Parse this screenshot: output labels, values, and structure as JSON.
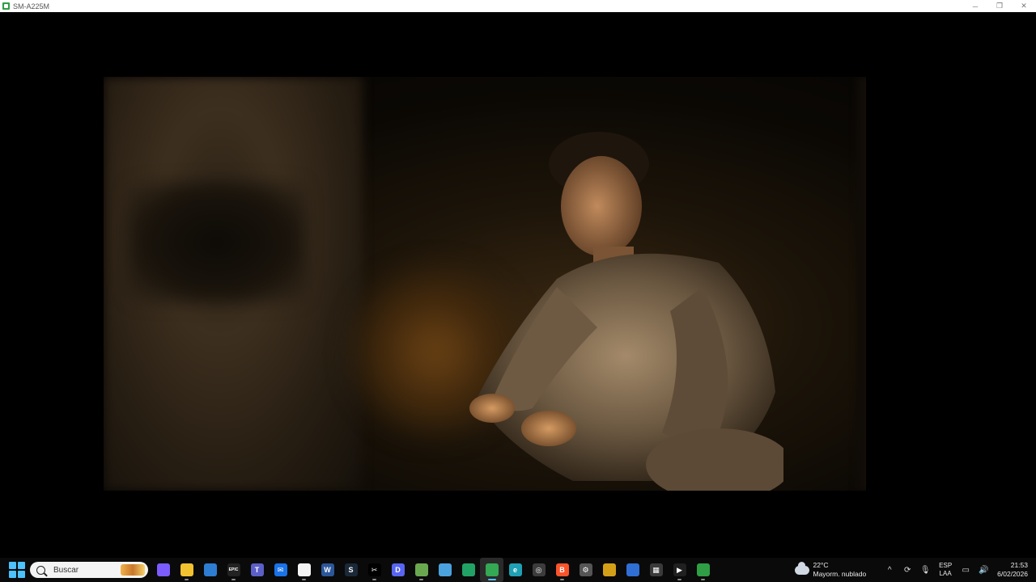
{
  "window": {
    "title": "SM-A225M",
    "minimize_glyph": "─",
    "restore_glyph": "❐",
    "close_glyph": "✕"
  },
  "video": {
    "description_icon": "video-frame"
  },
  "taskbar": {
    "search_placeholder": "Buscar",
    "apps": [
      {
        "name": "copilot-icon",
        "glyph": "",
        "color": "#7b5cff"
      },
      {
        "name": "file-explorer-icon",
        "glyph": "",
        "color": "#f2c230"
      },
      {
        "name": "microsoft-store-icon",
        "glyph": "",
        "color": "#2d7dd2"
      },
      {
        "name": "epic-games-icon",
        "glyph": "EPIC",
        "color": "#222222"
      },
      {
        "name": "teams-icon",
        "glyph": "T",
        "color": "#5b5fc7"
      },
      {
        "name": "mail-icon",
        "glyph": "✉",
        "color": "#1a73e8"
      },
      {
        "name": "blank-document-icon",
        "glyph": "",
        "color": "#f5f5f5"
      },
      {
        "name": "word-icon",
        "glyph": "W",
        "color": "#2b579a"
      },
      {
        "name": "steam-icon",
        "glyph": "S",
        "color": "#1b2838"
      },
      {
        "name": "capcut-icon",
        "glyph": "✂",
        "color": "#000000"
      },
      {
        "name": "discord-icon",
        "glyph": "D",
        "color": "#5865f2"
      },
      {
        "name": "game-app-icon",
        "glyph": "",
        "color": "#6aa84f"
      },
      {
        "name": "notepad-icon",
        "glyph": "",
        "color": "#4aa3df"
      },
      {
        "name": "phone-link-icon",
        "glyph": "",
        "color": "#21a366"
      },
      {
        "name": "chrome-icon",
        "glyph": "",
        "color": "#34a853"
      },
      {
        "name": "edge-icon",
        "glyph": "e",
        "color": "#1fa0b4"
      },
      {
        "name": "obs-icon",
        "glyph": "◎",
        "color": "#3c3c3c"
      },
      {
        "name": "brave-icon",
        "glyph": "B",
        "color": "#fb542b"
      },
      {
        "name": "settings-gear-icon",
        "glyph": "⚙",
        "color": "#555555"
      },
      {
        "name": "chrome-beta-icon",
        "glyph": "",
        "color": "#d4a017"
      },
      {
        "name": "paint-icon",
        "glyph": "",
        "color": "#2f6fd6"
      },
      {
        "name": "calculator-icon",
        "glyph": "▦",
        "color": "#3a3a3a"
      },
      {
        "name": "media-player-icon",
        "glyph": "▶",
        "color": "#202020"
      },
      {
        "name": "scrcpy-icon",
        "glyph": "",
        "color": "#2f9e44"
      }
    ],
    "weather": {
      "temperature": "22°C",
      "condition": "Mayorm. nublado"
    },
    "language": {
      "line1": "ESP",
      "line2": "LAA"
    },
    "clock": {
      "time": "21:53",
      "date": "6/02/2026"
    },
    "tray_glyphs": {
      "chevron": "^",
      "sync": "⟳",
      "mic": "🎙",
      "display": "▭",
      "volume": "🔊"
    }
  }
}
